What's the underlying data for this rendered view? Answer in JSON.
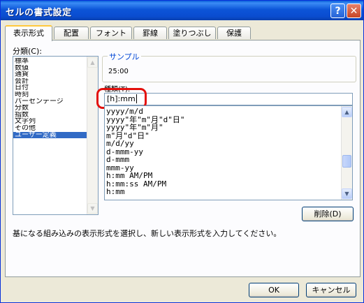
{
  "window": {
    "title": "セルの書式設定",
    "help_label": "?",
    "close_label": "✕"
  },
  "tabs": [
    {
      "label": "表示形式",
      "active": true
    },
    {
      "label": "配置"
    },
    {
      "label": "フォント"
    },
    {
      "label": "罫線"
    },
    {
      "label": "塗りつぶし"
    },
    {
      "label": "保護"
    }
  ],
  "category": {
    "label": "分類(C):",
    "items": [
      "標準",
      "数値",
      "通貨",
      "会計",
      "日付",
      "時刻",
      "パーセンテージ",
      "分数",
      "指数",
      "文字列",
      "その他",
      "ユーザー定義"
    ],
    "selected_index": 11
  },
  "sample": {
    "legend": "サンプル",
    "value": "25:00"
  },
  "type": {
    "label": "種類(T):",
    "value": "[h]:mm",
    "items": [
      "yyyy/m/d",
      "yyyy\"年\"m\"月\"d\"日\"",
      "yyyy\"年\"m\"月\"",
      "m\"月\"d\"日\"",
      "m/d/yy",
      "d-mmm-yy",
      "d-mmm",
      "mmm-yy",
      "h:mm AM/PM",
      "h:mm:ss AM/PM",
      "h:mm"
    ]
  },
  "delete_label": "削除(D)",
  "description": "基になる組み込みの表示形式を選択し、新しい表示形式を入力してください。",
  "ok_label": "OK",
  "cancel_label": "キャンセル",
  "colors": {
    "titlebar": "#0a4cd0",
    "selection": "#316ac5",
    "highlight": "#e3100c",
    "tab_accent": "#ffc83c"
  }
}
